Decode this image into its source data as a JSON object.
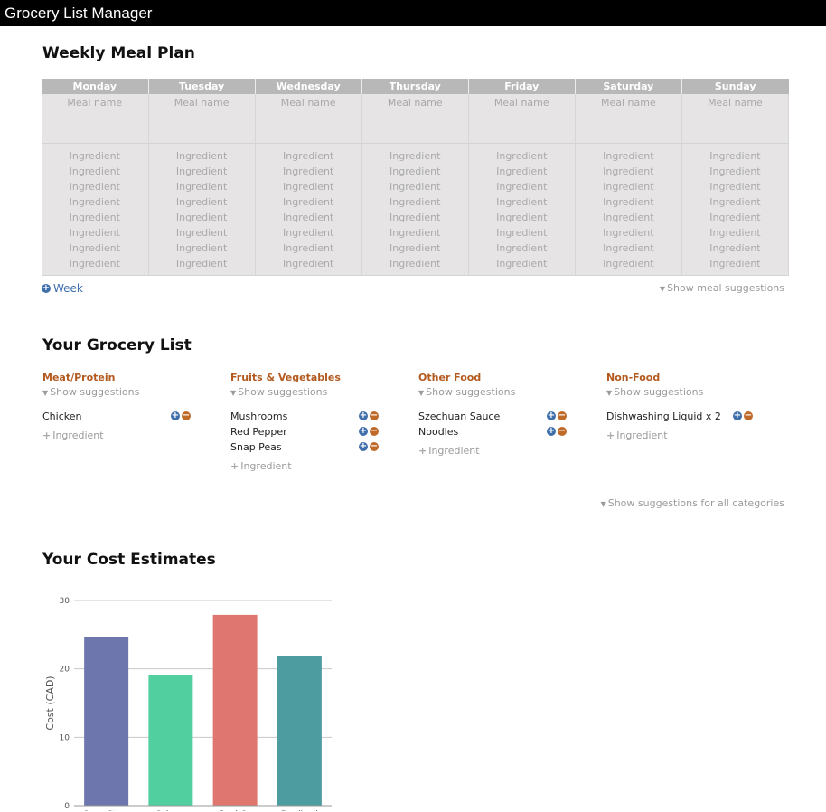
{
  "app": {
    "title": "Grocery List Manager"
  },
  "meal_plan": {
    "heading": "Weekly Meal Plan",
    "days": [
      "Monday",
      "Tuesday",
      "Wednesday",
      "Thursday",
      "Friday",
      "Saturday",
      "Sunday"
    ],
    "meal_placeholder": "Meal name",
    "ingredient_placeholder": "Ingredient",
    "add_week_label": "Week",
    "show_suggestions_label": "Show meal suggestions"
  },
  "grocery": {
    "heading": "Your Grocery List",
    "show_suggestions_label": "Show suggestions",
    "add_ingredient_label": "Ingredient",
    "show_all_label": "Show suggestions for all categories",
    "categories": [
      {
        "name": "Meat/Protein",
        "items": [
          "Chicken"
        ]
      },
      {
        "name": "Fruits & Vegetables",
        "items": [
          "Mushrooms",
          "Red Pepper",
          "Snap Peas"
        ]
      },
      {
        "name": "Other Food",
        "items": [
          "Szechuan Sauce",
          "Noodles"
        ]
      },
      {
        "name": "Non-Food",
        "items": [
          "Dishwashing Liquid x 2"
        ]
      }
    ]
  },
  "costs": {
    "heading": "Your Cost Estimates"
  },
  "chart_data": {
    "type": "bar",
    "categories": [
      "SuperStore",
      "Sobeys",
      "FreshCo",
      "Foodland"
    ],
    "values": [
      24.6,
      19.1,
      27.9,
      21.9
    ],
    "colors": [
      "#6d77ad",
      "#52cf9f",
      "#e07670",
      "#4d9da0"
    ],
    "ylabel": "Cost (CAD)",
    "ylim": [
      0,
      30
    ],
    "yticks": [
      0,
      10,
      20,
      30
    ],
    "grid": true
  }
}
